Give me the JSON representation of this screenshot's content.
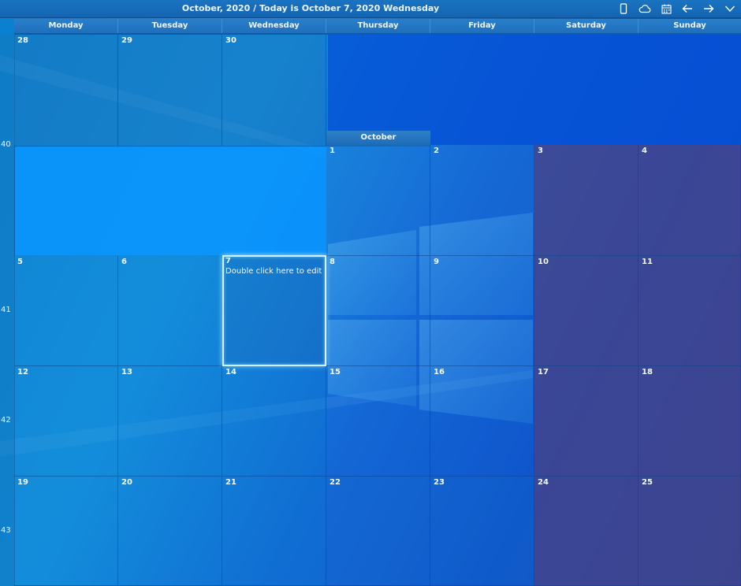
{
  "header": {
    "title": "October, 2020 / Today is October 7, 2020 Wednesday",
    "icons": [
      "phone-icon",
      "cloud-icon",
      "calendar-icon",
      "arrow-left-icon",
      "arrow-right-icon",
      "chevron-down-icon"
    ]
  },
  "days": [
    "Monday",
    "Tuesday",
    "Wednesday",
    "Thursday",
    "Friday",
    "Saturday",
    "Sunday"
  ],
  "weeks": [
    "40",
    "41",
    "42",
    "43"
  ],
  "month_label": "October",
  "today_hint": "Double click here to edit",
  "dates": {
    "sep28": "28",
    "sep29": "29",
    "sep30": "30",
    "d1": "1",
    "d2": "2",
    "d3": "3",
    "d4": "4",
    "d5": "5",
    "d6": "6",
    "d7": "7",
    "d8": "8",
    "d9": "9",
    "d10": "10",
    "d11": "11",
    "d12": "12",
    "d13": "13",
    "d14": "14",
    "d15": "15",
    "d16": "16",
    "d17": "17",
    "d18": "18",
    "d19": "19",
    "d20": "20",
    "d21": "21",
    "d22": "22",
    "d23": "23",
    "d24": "24",
    "d25": "25"
  },
  "colors": {
    "weekend": "#4f4a86",
    "today_border": "#cdf1ff",
    "header": "#1a74c2"
  }
}
